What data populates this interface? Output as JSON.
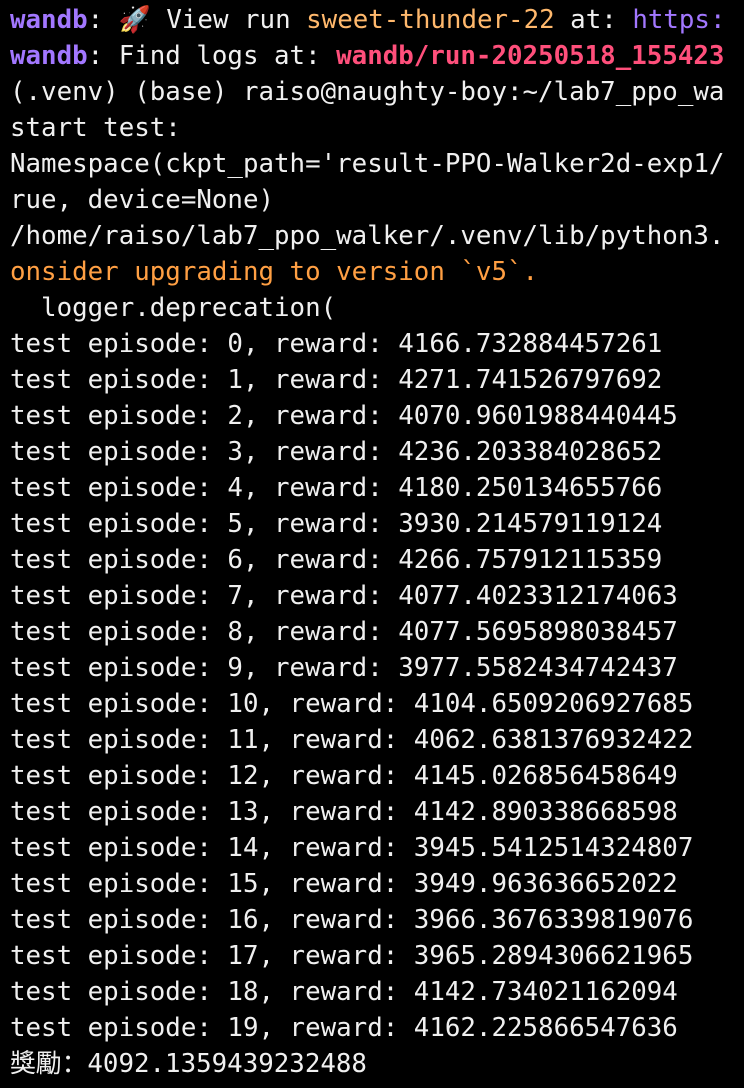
{
  "terminal": {
    "wandb_view_line": {
      "tag": "wandb",
      "sep": ": ",
      "icon": "rocket-emoji",
      "icon_glyph": "🚀",
      "text": " View run ",
      "run_name": "sweet-thunder-22",
      "mid": " at: ",
      "url": "https:"
    },
    "wandb_logs_line": {
      "tag": "wandb",
      "text": ": Find logs at: ",
      "path": "wandb/run-20250518_155423"
    },
    "prompt_line": "(.venv) (base) raiso@naughty-boy:~/lab7_ppo_wa",
    "start_line": "start test:",
    "namespace_line_1": "Namespace(ckpt_path='result-PPO-Walker2d-exp1/",
    "namespace_line_2": "rue, device=None)",
    "path_line": "/home/raiso/lab7_ppo_walker/.venv/lib/python3.",
    "warning_line": "onsider upgrading to version `v5`.",
    "logger_line": "  logger.deprecation(",
    "episodes": [
      "test episode: 0, reward: 4166.732884457261",
      "test episode: 1, reward: 4271.741526797692",
      "test episode: 2, reward: 4070.9601988440445",
      "test episode: 3, reward: 4236.203384028652",
      "test episode: 4, reward: 4180.250134655766",
      "test episode: 5, reward: 3930.214579119124",
      "test episode: 6, reward: 4266.757912115359",
      "test episode: 7, reward: 4077.4023312174063",
      "test episode: 8, reward: 4077.5695898038457",
      "test episode: 9, reward: 3977.5582434742437",
      "test episode: 10, reward: 4104.6509206927685",
      "test episode: 11, reward: 4062.6381376932422",
      "test episode: 12, reward: 4145.026856458649",
      "test episode: 13, reward: 4142.890338668598",
      "test episode: 14, reward: 3945.5412514324807",
      "test episode: 15, reward: 3949.963636652022",
      "test episode: 16, reward: 3966.3676339819076",
      "test episode: 17, reward: 3965.2894306621965",
      "test episode: 18, reward: 4142.734021162094",
      "test episode: 19, reward: 4162.225866547636"
    ],
    "final_line": "獎勵：4092.1359439232488",
    "colors": {
      "background": "#000000",
      "text": "#f0f0f0",
      "wandb_tag": "#a277ff",
      "run_name": "#ffb86c",
      "url": "#a277ff",
      "log_path": "#ff4f7b",
      "warning": "#ff9f43"
    }
  }
}
